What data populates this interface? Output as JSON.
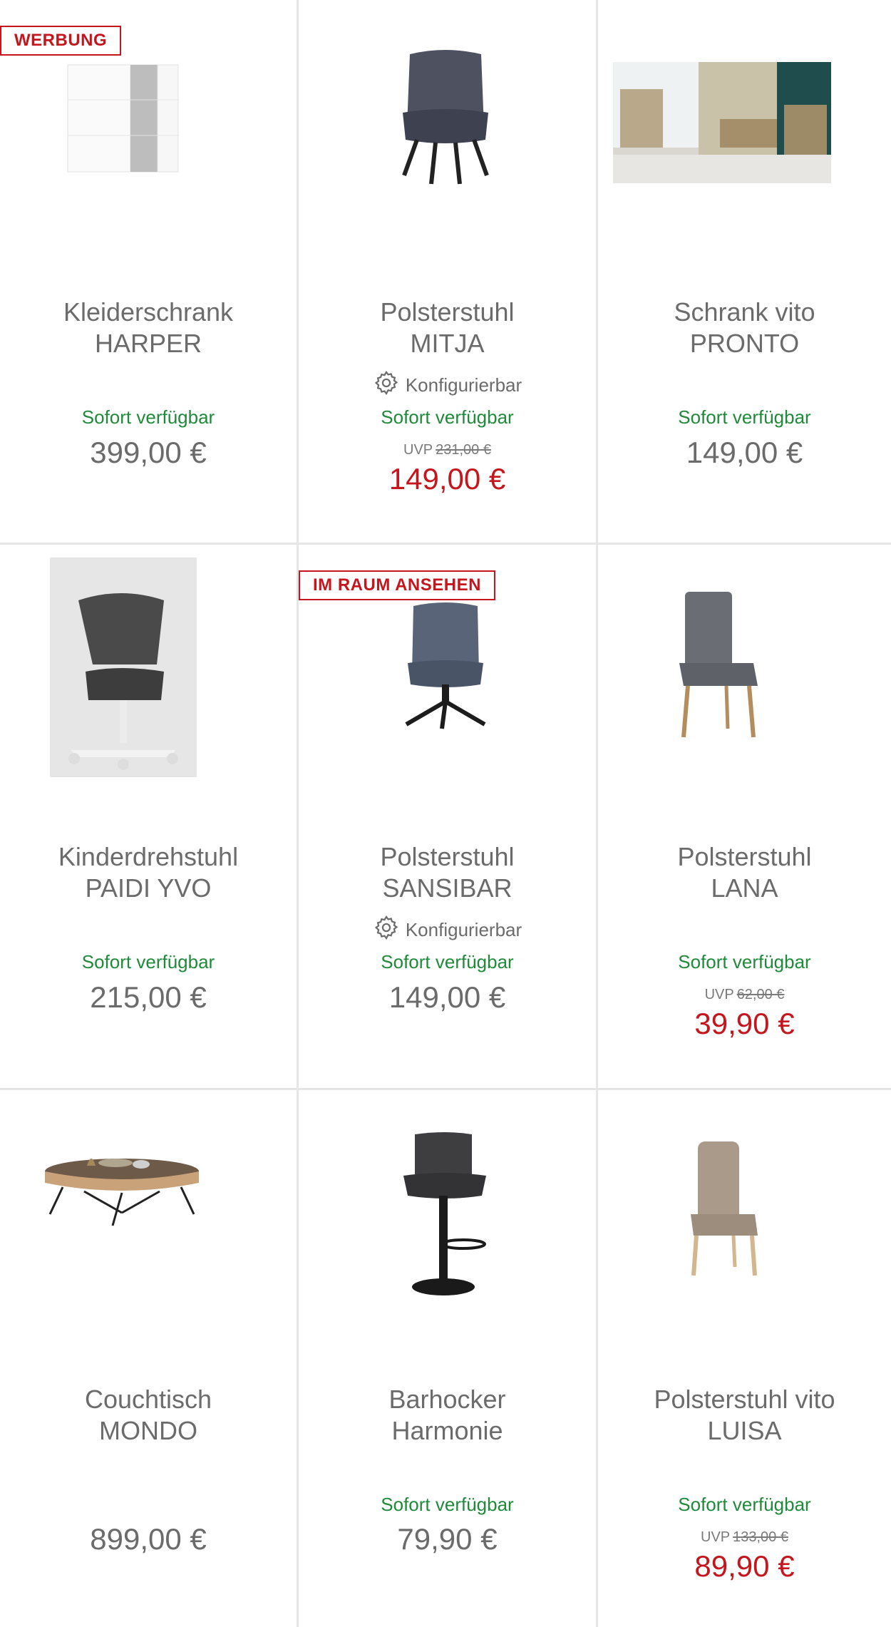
{
  "products": [
    {
      "badge": "WERBUNG",
      "name1": "Kleiderschrank",
      "name2": "HARPER",
      "config": "",
      "avail": "Sofort verfügbar",
      "uvp_label": "",
      "uvp_value": "",
      "price": "399,00 €",
      "sale": false,
      "icon": "wardrobe-image"
    },
    {
      "badge": "",
      "name1": "Polsterstuhl",
      "name2": "MITJA",
      "config": "Konfigurierbar",
      "avail": "Sofort verfügbar",
      "uvp_label": "UVP",
      "uvp_value": "231,00 €",
      "price": "149,00 €",
      "sale": true,
      "icon": "armchair-image"
    },
    {
      "badge": "",
      "name1": "Schrank vito",
      "name2": "PRONTO",
      "config": "",
      "avail": "Sofort verfügbar",
      "uvp_label": "",
      "uvp_value": "",
      "price": "149,00 €",
      "sale": false,
      "icon": "room-photo-image"
    },
    {
      "badge": "",
      "name1": "Kinderdrehstuhl",
      "name2": "PAIDI YVO",
      "config": "",
      "avail": "Sofort verfügbar",
      "uvp_label": "",
      "uvp_value": "",
      "price": "215,00 €",
      "sale": false,
      "icon": "office-chair-image"
    },
    {
      "badge": "IM RAUM ANSEHEN",
      "name1": "Polsterstuhl",
      "name2": "SANSIBAR",
      "config": "Konfigurierbar",
      "avail": "Sofort verfügbar",
      "uvp_label": "",
      "uvp_value": "",
      "price": "149,00 €",
      "sale": false,
      "icon": "swivel-chair-image"
    },
    {
      "badge": "",
      "name1": "Polsterstuhl",
      "name2": "LANA",
      "config": "",
      "avail": "Sofort verfügbar",
      "uvp_label": "UVP",
      "uvp_value": "62,00 €",
      "price": "39,90 €",
      "sale": true,
      "icon": "dining-chair-image"
    },
    {
      "badge": "",
      "name1": "Couchtisch",
      "name2": "MONDO",
      "config": "",
      "avail": "",
      "uvp_label": "",
      "uvp_value": "",
      "price": "899,00 €",
      "sale": false,
      "icon": "coffee-table-image"
    },
    {
      "badge": "",
      "name1": "Barhocker",
      "name2": "Harmonie",
      "config": "",
      "avail": "Sofort verfügbar",
      "uvp_label": "",
      "uvp_value": "",
      "price": "79,90 €",
      "sale": false,
      "icon": "bar-stool-image"
    },
    {
      "badge": "",
      "name1": "Polsterstuhl vito",
      "name2": "LUISA",
      "config": "",
      "avail": "Sofort verfügbar",
      "uvp_label": "UVP",
      "uvp_value": "133,00 €",
      "price": "89,90 €",
      "sale": true,
      "icon": "high-back-chair-image"
    }
  ],
  "colors": {
    "accent": "#c4161c",
    "available": "#1f8a3a",
    "text": "#6b6b6b",
    "divider": "#e6e6e6"
  }
}
